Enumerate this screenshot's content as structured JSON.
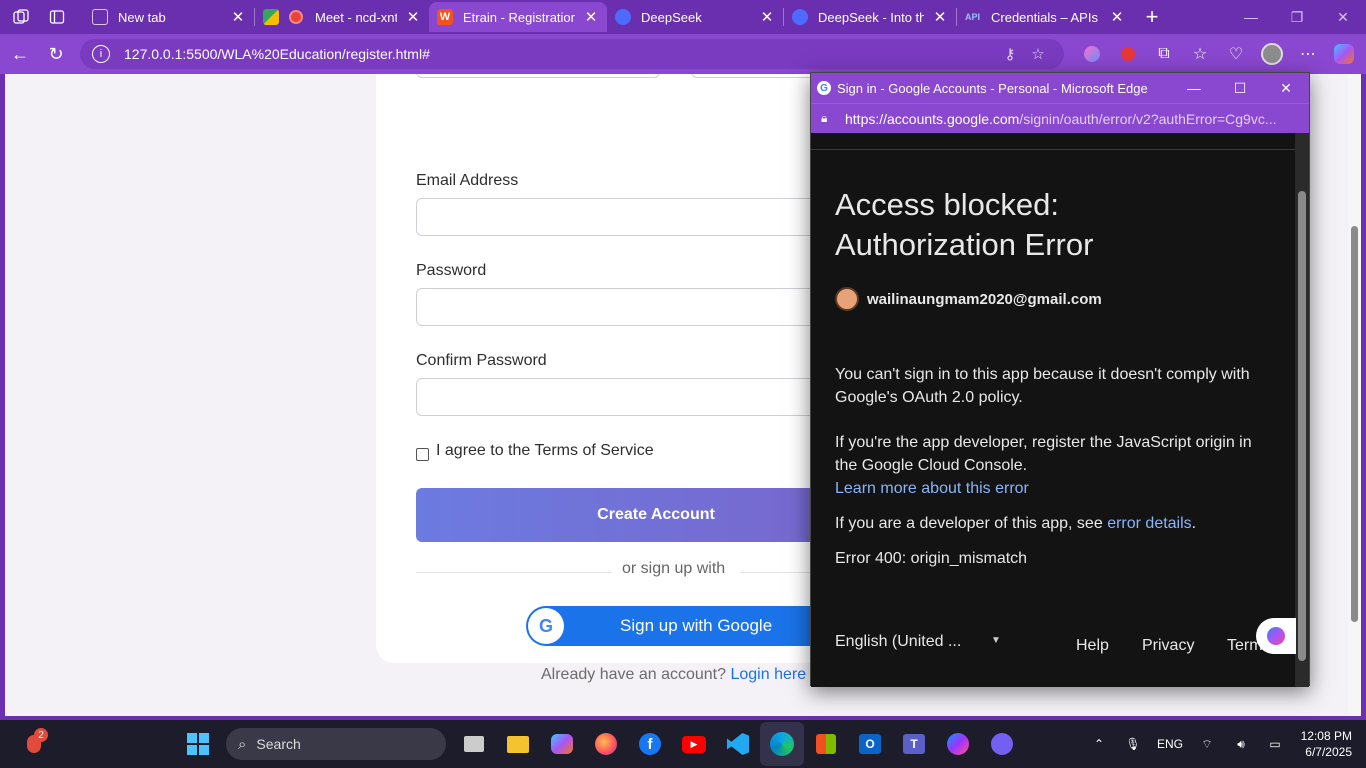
{
  "browser": {
    "tabs": [
      {
        "title": "New tab",
        "favicon_color": "#8a47cf"
      },
      {
        "title": "Meet - ncd-xntn-",
        "favicon_color": "#ea4335"
      },
      {
        "title": "Etrain - Registration",
        "favicon_color": "#f4511e",
        "active": true
      },
      {
        "title": "DeepSeek",
        "favicon_color": "#4d6bfe"
      },
      {
        "title": "DeepSeek - Into the U",
        "favicon_color": "#4d6bfe"
      },
      {
        "title": "Credentials – APIs & S",
        "favicon_color": "#3c7cf4",
        "favicon_text": "API"
      }
    ],
    "url": "127.0.0.1:5500/WLA%20Education/register.html#"
  },
  "form": {
    "email_label": "Email Address",
    "password_label": "Password",
    "confirm_label": "Confirm Password",
    "terms_label": "I agree to the Terms of Service",
    "create_button": "Create Account",
    "divider_text": "or sign up with",
    "google_button": "Sign up with Google",
    "login_prompt": "Already have an account?",
    "login_link": "Login here"
  },
  "popup": {
    "window_title": "Sign in - Google Accounts - Personal - Microsoft Edge",
    "url_host": "https://accounts.google.com",
    "url_path": "/signin/oauth/error/v2?authError=Cg9vc...",
    "heading_line1": "Access blocked:",
    "heading_line2": "Authorization Error",
    "email": "wailinaungmam2020@gmail.com",
    "para1": "You can't sign in to this app because it doesn't comply with Google's OAuth 2.0 policy.",
    "para2": "If you're the app developer, register the JavaScript origin in the Google Cloud Console.",
    "learn_more": "Learn more about this error",
    "para3_prefix": "If you are a developer of this app, see",
    "error_details": "error details",
    "para3_suffix": ".",
    "error_code": "Error 400: origin_mismatch",
    "language": "English (United ...",
    "help": "Help",
    "privacy": "Privacy",
    "terms": "Term"
  },
  "taskbar": {
    "search_label": "Search",
    "notification_count": "2",
    "language": "ENG",
    "time": "12:08 PM",
    "date": "6/7/2025"
  }
}
